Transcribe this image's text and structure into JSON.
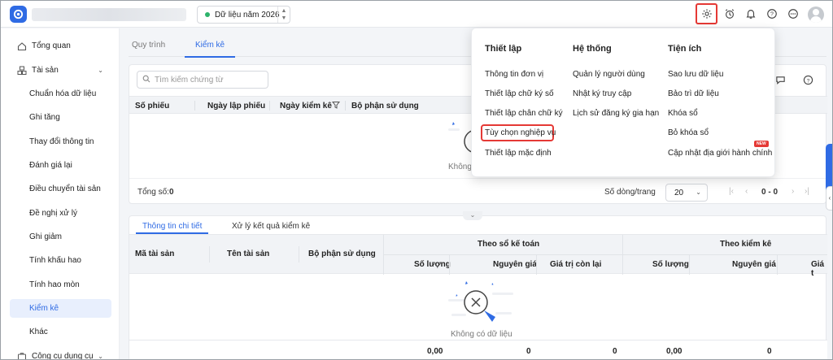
{
  "header": {
    "year_label": "Dữ liệu năm 2026"
  },
  "sidebar": {
    "items": [
      {
        "label": "Tổng quan"
      },
      {
        "label": "Tài sản"
      },
      {
        "label": "Chuẩn hóa dữ liệu"
      },
      {
        "label": "Ghi tăng"
      },
      {
        "label": "Thay đổi thông tin"
      },
      {
        "label": "Đánh giá lại"
      },
      {
        "label": "Điều chuyển tài sản"
      },
      {
        "label": "Đề nghị xử lý"
      },
      {
        "label": "Ghi giảm"
      },
      {
        "label": "Tính khấu hao"
      },
      {
        "label": "Tính hao mòn"
      },
      {
        "label": "Kiểm kê"
      },
      {
        "label": "Khác"
      },
      {
        "label": "Công cụ dụng cụ"
      }
    ]
  },
  "main": {
    "tabs": [
      {
        "label": "Quy trình"
      },
      {
        "label": "Kiểm kê"
      }
    ],
    "search_placeholder": "Tìm kiếm chứng từ",
    "columns": [
      "Số phiếu",
      "Ngày lập phiếu",
      "Ngày kiểm kê",
      "Bộ phận sử dụng"
    ],
    "empty_partial": "Không",
    "total_label": "Tổng số:",
    "total_value": "0",
    "rows_label": "Số dòng/trang",
    "rows_value": "20",
    "page_range": "0 - 0"
  },
  "detail": {
    "tabs": [
      {
        "label": "Thông tin chi tiết"
      },
      {
        "label": "Xử lý kết quả kiểm kê"
      }
    ],
    "col_asset_code": "Mã tài sản",
    "col_asset_name": "Tên tài sản",
    "col_dept": "Bộ phận sử dụng",
    "group_book": "Theo sổ kế toán",
    "group_check": "Theo kiểm kê",
    "sub_qty": "Số lượng",
    "sub_cost": "Nguyên giá",
    "sub_remain": "Giá trị còn lại",
    "sub_qty2": "Số lượng",
    "sub_cost2": "Nguyên giá",
    "sub_partial": "Giá t",
    "empty_label": "Không có dữ liệu",
    "totals": [
      "0,00",
      "0",
      "0",
      "0,00",
      "0"
    ]
  },
  "dropdown": {
    "col1": {
      "heading": "Thiết lập",
      "items": [
        "Thông tin đơn vị",
        "Thiết lập chữ ký số",
        "Thiết lập chân chữ ký",
        "Tùy chọn nghiệp vụ",
        "Thiết lập mặc định"
      ]
    },
    "col2": {
      "heading": "Hệ thống",
      "items": [
        "Quản lý người dùng",
        "Nhật ký truy cập",
        "Lịch sử đăng ký gia hạn"
      ]
    },
    "col3": {
      "heading": "Tiện ích",
      "items": [
        "Sao lưu dữ liệu",
        "Bảo trì dữ liệu",
        "Khóa sổ",
        "Bỏ khóa sổ",
        "Cập nhật địa giới hành chính"
      ],
      "badge": "NEW"
    }
  },
  "colors": {
    "accent": "#2f6be4",
    "highlight": "#e53935"
  }
}
